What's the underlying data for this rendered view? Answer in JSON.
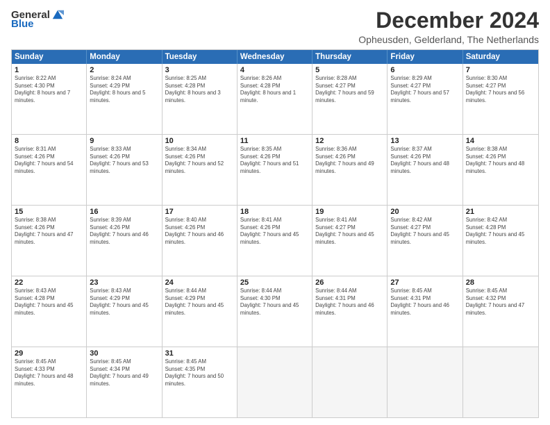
{
  "logo": {
    "general": "General",
    "blue": "Blue"
  },
  "title": "December 2024",
  "subtitle": "Opheusden, Gelderland, The Netherlands",
  "days": [
    "Sunday",
    "Monday",
    "Tuesday",
    "Wednesday",
    "Thursday",
    "Friday",
    "Saturday"
  ],
  "weeks": [
    [
      {
        "day": "1",
        "sunrise": "8:22 AM",
        "sunset": "4:30 PM",
        "daylight": "8 hours and 7 minutes."
      },
      {
        "day": "2",
        "sunrise": "8:24 AM",
        "sunset": "4:29 PM",
        "daylight": "8 hours and 5 minutes."
      },
      {
        "day": "3",
        "sunrise": "8:25 AM",
        "sunset": "4:28 PM",
        "daylight": "8 hours and 3 minutes."
      },
      {
        "day": "4",
        "sunrise": "8:26 AM",
        "sunset": "4:28 PM",
        "daylight": "8 hours and 1 minute."
      },
      {
        "day": "5",
        "sunrise": "8:28 AM",
        "sunset": "4:27 PM",
        "daylight": "7 hours and 59 minutes."
      },
      {
        "day": "6",
        "sunrise": "8:29 AM",
        "sunset": "4:27 PM",
        "daylight": "7 hours and 57 minutes."
      },
      {
        "day": "7",
        "sunrise": "8:30 AM",
        "sunset": "4:27 PM",
        "daylight": "7 hours and 56 minutes."
      }
    ],
    [
      {
        "day": "8",
        "sunrise": "8:31 AM",
        "sunset": "4:26 PM",
        "daylight": "7 hours and 54 minutes."
      },
      {
        "day": "9",
        "sunrise": "8:33 AM",
        "sunset": "4:26 PM",
        "daylight": "7 hours and 53 minutes."
      },
      {
        "day": "10",
        "sunrise": "8:34 AM",
        "sunset": "4:26 PM",
        "daylight": "7 hours and 52 minutes."
      },
      {
        "day": "11",
        "sunrise": "8:35 AM",
        "sunset": "4:26 PM",
        "daylight": "7 hours and 51 minutes."
      },
      {
        "day": "12",
        "sunrise": "8:36 AM",
        "sunset": "4:26 PM",
        "daylight": "7 hours and 49 minutes."
      },
      {
        "day": "13",
        "sunrise": "8:37 AM",
        "sunset": "4:26 PM",
        "daylight": "7 hours and 48 minutes."
      },
      {
        "day": "14",
        "sunrise": "8:38 AM",
        "sunset": "4:26 PM",
        "daylight": "7 hours and 48 minutes."
      }
    ],
    [
      {
        "day": "15",
        "sunrise": "8:38 AM",
        "sunset": "4:26 PM",
        "daylight": "7 hours and 47 minutes."
      },
      {
        "day": "16",
        "sunrise": "8:39 AM",
        "sunset": "4:26 PM",
        "daylight": "7 hours and 46 minutes."
      },
      {
        "day": "17",
        "sunrise": "8:40 AM",
        "sunset": "4:26 PM",
        "daylight": "7 hours and 46 minutes."
      },
      {
        "day": "18",
        "sunrise": "8:41 AM",
        "sunset": "4:26 PM",
        "daylight": "7 hours and 45 minutes."
      },
      {
        "day": "19",
        "sunrise": "8:41 AM",
        "sunset": "4:27 PM",
        "daylight": "7 hours and 45 minutes."
      },
      {
        "day": "20",
        "sunrise": "8:42 AM",
        "sunset": "4:27 PM",
        "daylight": "7 hours and 45 minutes."
      },
      {
        "day": "21",
        "sunrise": "8:42 AM",
        "sunset": "4:28 PM",
        "daylight": "7 hours and 45 minutes."
      }
    ],
    [
      {
        "day": "22",
        "sunrise": "8:43 AM",
        "sunset": "4:28 PM",
        "daylight": "7 hours and 45 minutes."
      },
      {
        "day": "23",
        "sunrise": "8:43 AM",
        "sunset": "4:29 PM",
        "daylight": "7 hours and 45 minutes."
      },
      {
        "day": "24",
        "sunrise": "8:44 AM",
        "sunset": "4:29 PM",
        "daylight": "7 hours and 45 minutes."
      },
      {
        "day": "25",
        "sunrise": "8:44 AM",
        "sunset": "4:30 PM",
        "daylight": "7 hours and 45 minutes."
      },
      {
        "day": "26",
        "sunrise": "8:44 AM",
        "sunset": "4:31 PM",
        "daylight": "7 hours and 46 minutes."
      },
      {
        "day": "27",
        "sunrise": "8:45 AM",
        "sunset": "4:31 PM",
        "daylight": "7 hours and 46 minutes."
      },
      {
        "day": "28",
        "sunrise": "8:45 AM",
        "sunset": "4:32 PM",
        "daylight": "7 hours and 47 minutes."
      }
    ],
    [
      {
        "day": "29",
        "sunrise": "8:45 AM",
        "sunset": "4:33 PM",
        "daylight": "7 hours and 48 minutes."
      },
      {
        "day": "30",
        "sunrise": "8:45 AM",
        "sunset": "4:34 PM",
        "daylight": "7 hours and 49 minutes."
      },
      {
        "day": "31",
        "sunrise": "8:45 AM",
        "sunset": "4:35 PM",
        "daylight": "7 hours and 50 minutes."
      },
      null,
      null,
      null,
      null
    ]
  ]
}
